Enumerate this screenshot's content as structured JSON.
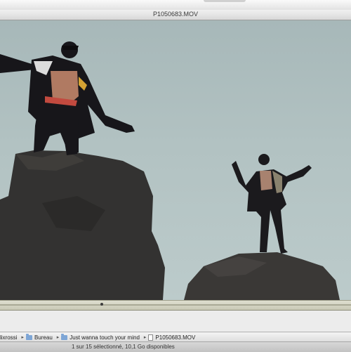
{
  "window": {
    "title": "P1050683.MOV"
  },
  "path_bar": {
    "items": [
      {
        "label": "lixrossi",
        "icon": "home-icon"
      },
      {
        "label": "Bureau",
        "icon": "folder-icon"
      },
      {
        "label": "Just wanna touch your mind",
        "icon": "folder-icon"
      },
      {
        "label": "P1050683.MOV",
        "icon": "movie-file-icon"
      }
    ],
    "separator": "▸"
  },
  "status": {
    "text": "1 sur 15 sélectionné, 10,1 Go disponibles"
  },
  "player": {
    "playhead_fraction": 0.29
  },
  "colors": {
    "sky": "#b2c2c2",
    "rock": "#343331",
    "silhouette": "#17161a",
    "scrubber": "#d6d6c5"
  }
}
